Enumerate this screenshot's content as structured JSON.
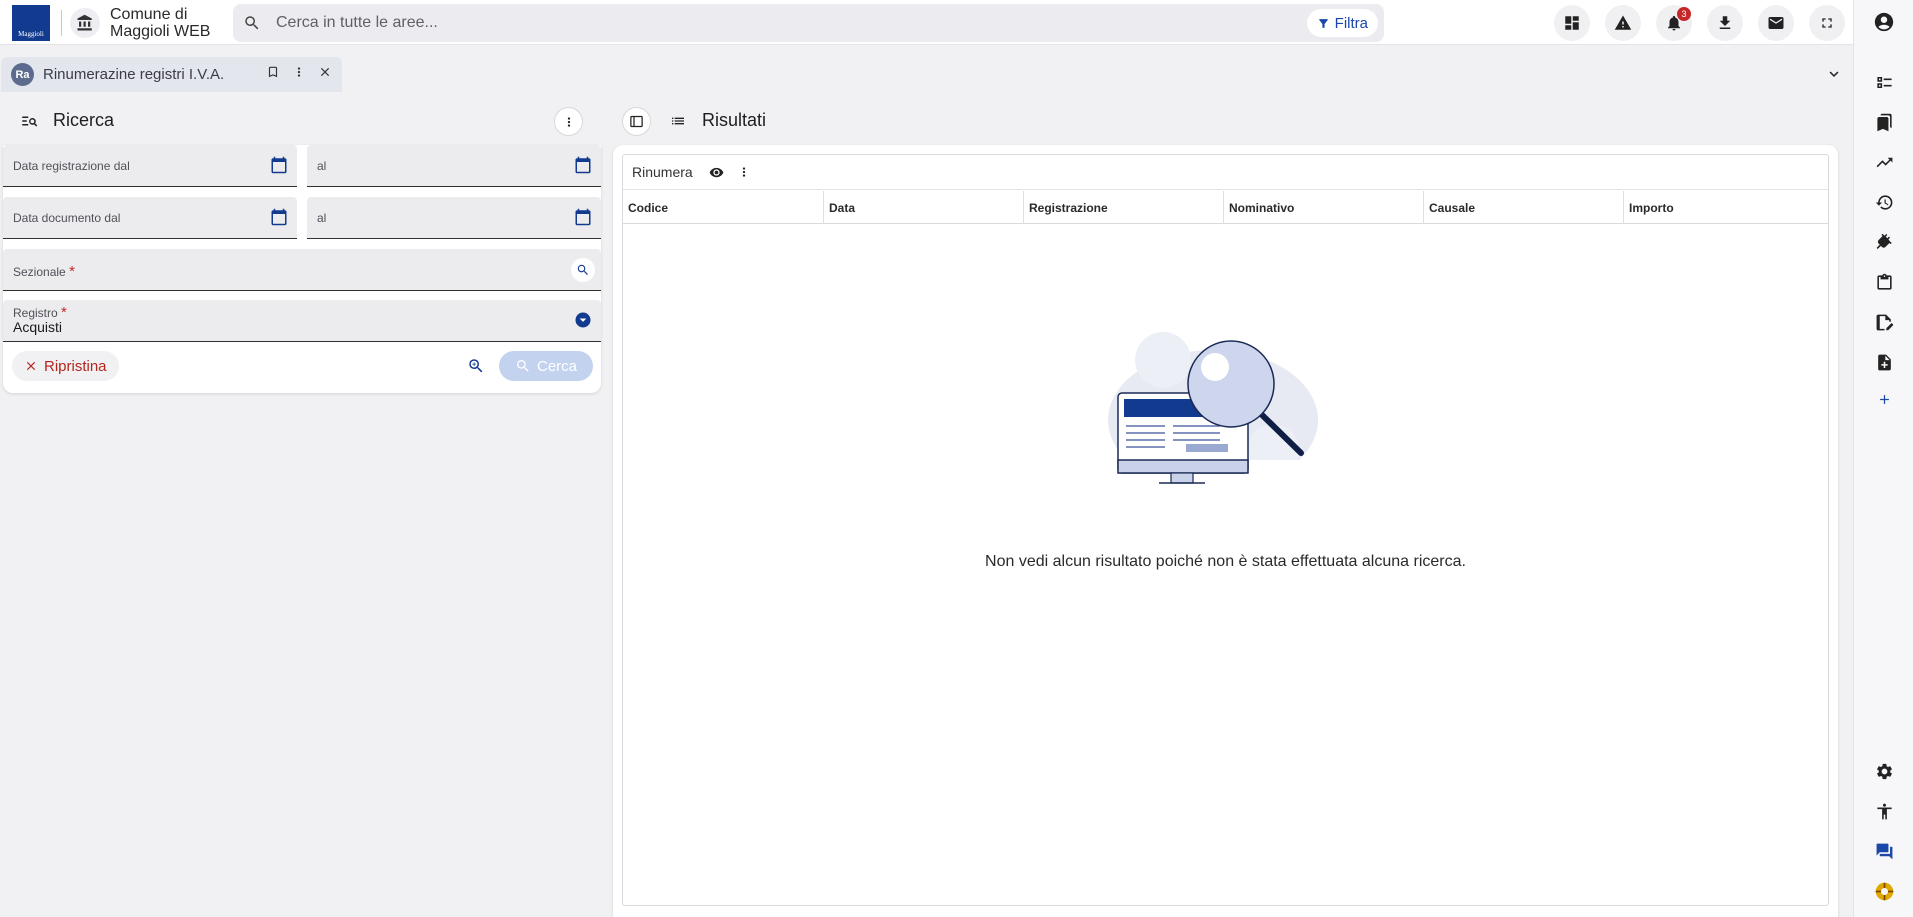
{
  "app": {
    "logo_text": "Maggioli",
    "org_name": "Comune di\nMaggioli WEB"
  },
  "search": {
    "placeholder": "Cerca in tutte le aree...",
    "filter_label": "Filtra"
  },
  "topbar": {
    "notifications_count": "3"
  },
  "tab": {
    "avatar": "Ra",
    "title": "Rinumerazine registri I.V.A."
  },
  "ricerca": {
    "title": "Ricerca",
    "fields": {
      "data_reg_dal": "Data registrazione dal",
      "data_reg_al": "al",
      "data_doc_dal": "Data documento dal",
      "data_doc_al": "al",
      "sezionale": "Sezionale",
      "registro": "Registro",
      "registro_value": "Acquisti"
    },
    "required_mark": "*",
    "reset_label": "Ripristina",
    "search_label": "Cerca"
  },
  "risultati": {
    "title": "Risultati",
    "toolbar_label": "Rinumera",
    "columns": [
      "Codice",
      "Data",
      "Registrazione",
      "Nominativo",
      "Causale",
      "Importo"
    ],
    "empty_message": "Non vedi alcun risultato poiché non è stata effettuata alcuna ricerca."
  },
  "colors": {
    "primary": "#1a47a8",
    "danger": "#c62828",
    "disabled_button": "#c3d2ef"
  },
  "icons": {
    "top": [
      "dashboard-icon",
      "warning-icon",
      "bell-icon",
      "download-icon",
      "mail-icon",
      "fullscreen-icon"
    ],
    "rail": [
      "account-icon",
      "checklist-icon",
      "bookmarks-icon",
      "trending-icon",
      "history-icon",
      "plugin-icon",
      "clipboard-icon",
      "edit-document-icon",
      "add-document-icon",
      "add-icon",
      "settings-icon",
      "accessibility-icon",
      "chat-icon",
      "support-icon"
    ]
  }
}
